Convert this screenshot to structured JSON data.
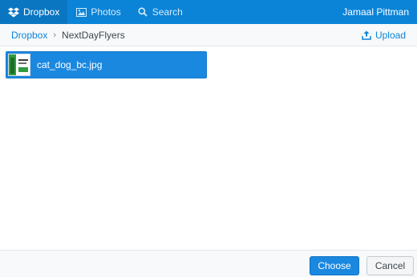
{
  "topbar": {
    "tabs": [
      {
        "label": "Dropbox",
        "icon": "dropbox-icon",
        "active": true
      },
      {
        "label": "Photos",
        "icon": "photos-icon",
        "active": false
      },
      {
        "label": "Search",
        "icon": "search-icon",
        "active": false
      }
    ],
    "user_name": "Jamaal Pittman",
    "colors": {
      "bar": "#0b84d8",
      "active_tab": "#0a76c2"
    }
  },
  "breadcrumb": {
    "root": "Dropbox",
    "separator": "›",
    "current": "NextDayFlyers",
    "upload_label": "Upload"
  },
  "files": [
    {
      "name": "cat_dog_bc.jpg",
      "icon": "image-thumbnail",
      "selected": true
    }
  ],
  "footer": {
    "choose_label": "Choose",
    "cancel_label": "Cancel",
    "colors": {
      "primary": "#1b88e0"
    }
  }
}
